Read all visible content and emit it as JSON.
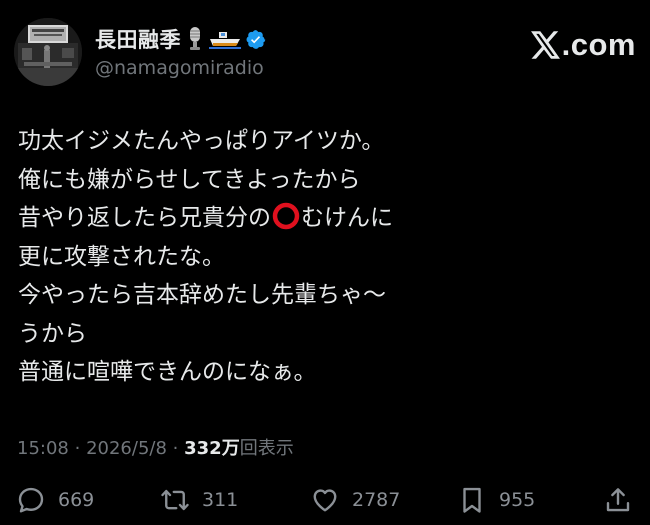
{
  "user": {
    "display_name": "長田融季",
    "handle": "@namagomiradio",
    "verified": true,
    "name_emojis": [
      "microphone-icon",
      "boat-icon"
    ]
  },
  "brand": {
    "logo_text": ".com"
  },
  "post": {
    "lines": [
      "功太イジメたんやっぱりアイツか。",
      "俺にも嫌がらせしてきよったから",
      "昔やり返したら兄貴分の",
      "むけんに",
      "更に攻撃されたな。",
      "今やったら吉本辞めたし先輩ちゃ〜",
      "うから",
      "普通に喧嘩できんのになぁ。"
    ],
    "time": "15:08",
    "separator": "·",
    "date": "2026/5/8",
    "views": "332万",
    "views_label": "回表示"
  },
  "actions": {
    "replies": "669",
    "reposts": "311",
    "likes": "2787",
    "bookmarks": "955"
  },
  "colors": {
    "background": "#000000",
    "text": "#e7e9ea",
    "muted": "#71767b",
    "verified": "#1d9bf0",
    "circle": "#e0101e"
  }
}
